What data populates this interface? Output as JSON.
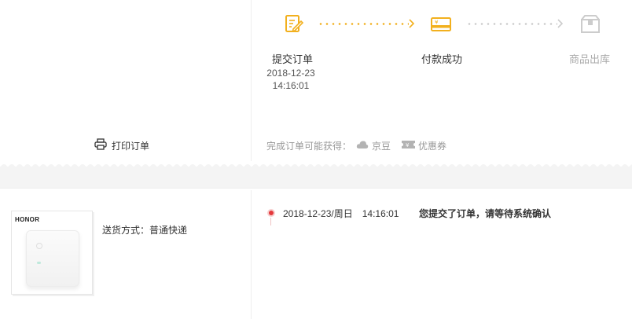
{
  "progress": {
    "steps": [
      {
        "label": "提交订单",
        "date": "2018-12-23",
        "time": "14:16:01",
        "icon": "edit-document-icon",
        "state": "done"
      },
      {
        "label": "付款成功",
        "icon": "payment-card-icon",
        "state": "done"
      },
      {
        "label": "商品出库",
        "icon": "package-icon",
        "state": "pending"
      }
    ],
    "colors": {
      "done": "#f2b01e",
      "pending": "#cccccc"
    }
  },
  "actions": {
    "print_label": "打印订单"
  },
  "rewards": {
    "prefix": "完成订单可能获得：",
    "items": [
      {
        "label": "京豆",
        "icon": "cloud-bean-icon"
      },
      {
        "label": "优惠券",
        "icon": "coupon-icon"
      }
    ]
  },
  "product": {
    "brand": "HONOR",
    "shipping": "送货方式：普通快递"
  },
  "tracking": {
    "entries": [
      {
        "time": "2018-12-23/周日　14:16:01",
        "message": "您提交了订单，请等待系统确认"
      }
    ],
    "accent": "#e4393c"
  }
}
